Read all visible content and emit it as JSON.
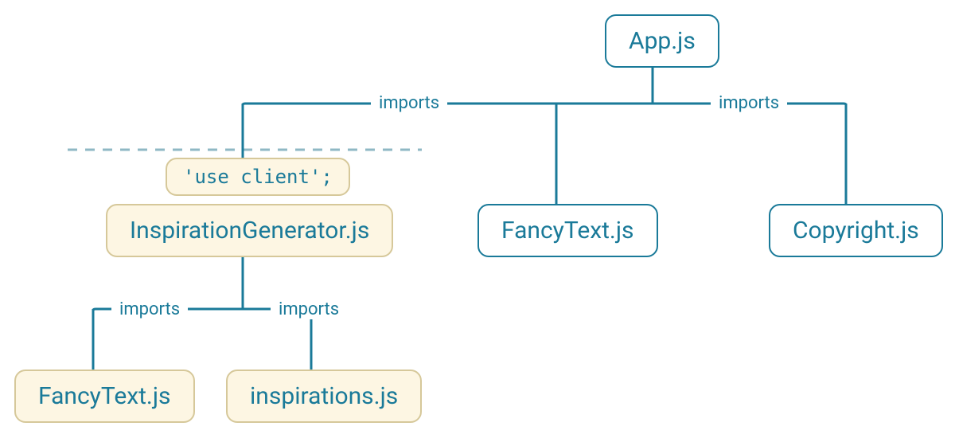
{
  "nodes": {
    "app": {
      "label": "App.js"
    },
    "inspiration_generator": {
      "label": "InspirationGenerator.js",
      "directive": "'use client';"
    },
    "fancy_text_server": {
      "label": "FancyText.js"
    },
    "copyright": {
      "label": "Copyright.js"
    },
    "fancy_text_client": {
      "label": "FancyText.js"
    },
    "inspirations": {
      "label": "inspirations.js"
    }
  },
  "edges": {
    "app_to_inspiration": {
      "label": "imports"
    },
    "app_to_fancytext": {
      "label": ""
    },
    "app_to_copyright": {
      "label": "imports"
    },
    "inspiration_to_fancytext": {
      "label": "imports"
    },
    "inspiration_to_inspirations": {
      "label": "imports"
    }
  }
}
